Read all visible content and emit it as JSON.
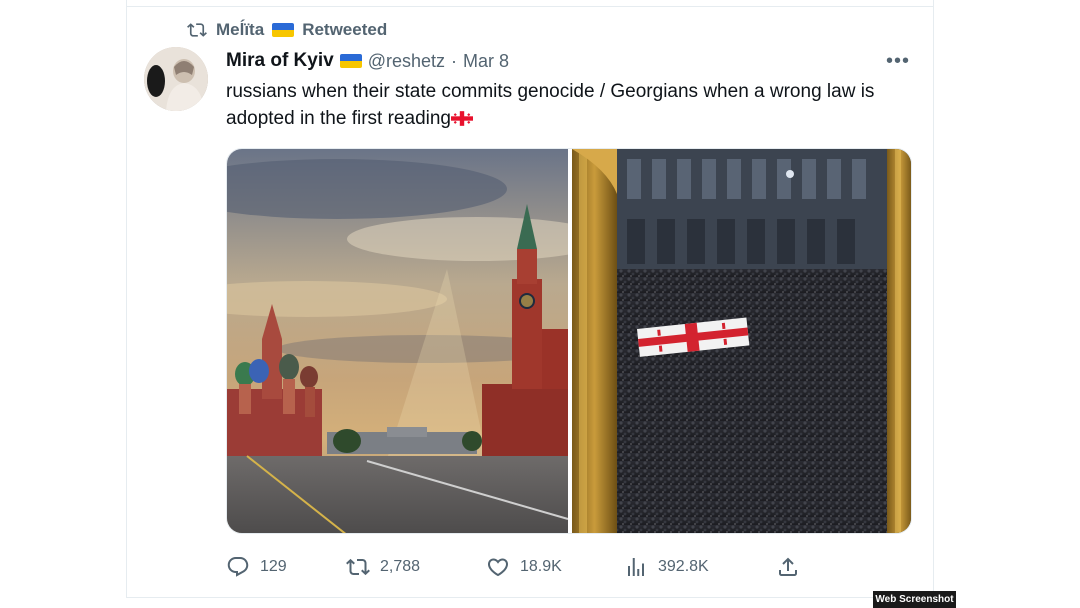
{
  "retweet": {
    "user": "Meĺïta",
    "label": "Retweeted"
  },
  "author": {
    "name": "Mira of Kyiv",
    "handle": "@reshetz",
    "date": "Mar 8"
  },
  "tweet": {
    "text": "russians when their state commits genocide / Georgians when a wrong law is adopted in the first reading",
    "emoji_icon": "georgia-flag-icon"
  },
  "media": {
    "left_image": "red-square-kremlin-photo",
    "right_image": "tbilisi-protest-crowd-photo"
  },
  "actions": {
    "replies": "129",
    "retweets": "2,788",
    "likes": "18.9K",
    "views": "392.8K"
  },
  "watermark": "Web Screenshot",
  "colors": {
    "text": "#0f1419",
    "secondary": "#536471",
    "ukraine_blue": "#2a6ad6",
    "ukraine_yellow": "#f7c600",
    "georgia_red": "#e8112d"
  }
}
